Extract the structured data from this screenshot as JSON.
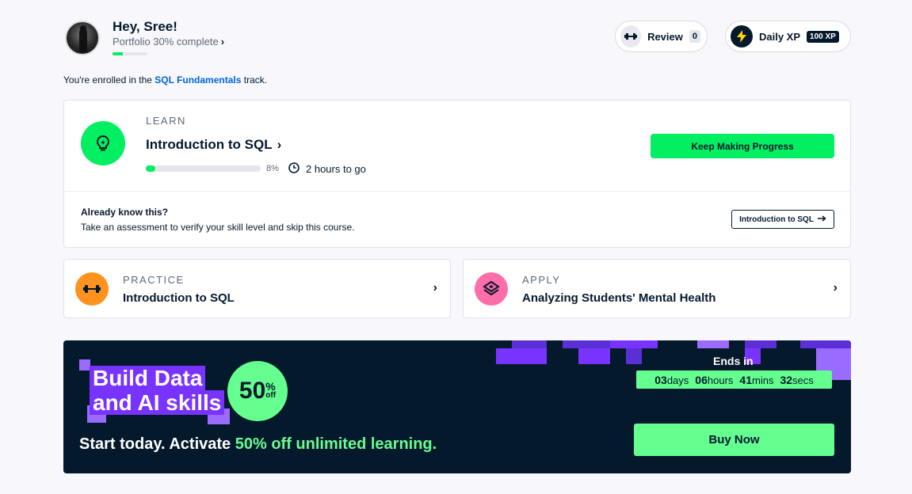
{
  "header": {
    "greeting": "Hey, Sree!",
    "portfolio_text": "Portfolio 30% complete",
    "portfolio_progress": 0.3,
    "review_label": "Review",
    "review_count": "0",
    "xp_label": "Daily XP",
    "xp_value": "100 XP"
  },
  "track": {
    "prefix": "You're enrolled in the",
    "name": "SQL Fundamentals",
    "suffix": "track."
  },
  "learn": {
    "tag": "LEARN",
    "title": "Introduction to SQL",
    "progress_percent": 8,
    "progress_label": "8%",
    "time_left": "2 hours to go",
    "cta": "Keep Making Progress",
    "already_title": "Already know this?",
    "already_desc": "Take an assessment to verify your skill level and skip this course.",
    "assessment_button": "Introduction to SQL"
  },
  "practice": {
    "tag": "PRACTICE",
    "title": "Introduction to SQL"
  },
  "apply": {
    "tag": "APPLY",
    "title": "Analyzing Students' Mental Health"
  },
  "promo": {
    "headline_line1": "Build Data",
    "headline_line2": "and AI skills",
    "discount_number": "50",
    "discount_percent": "%",
    "discount_off": "off",
    "sub_prefix": "Start today. Activate",
    "sub_highlight": "50% off unlimited learning.",
    "ends_label": "Ends in",
    "days": "03",
    "days_unit": "days",
    "hours": "06",
    "hours_unit": "hours",
    "mins": "41",
    "mins_unit": "mins",
    "secs": "32",
    "secs_unit": "secs",
    "buy_label": "Buy Now"
  },
  "colors": {
    "brand_green": "#03ef62",
    "promo_green": "#65ff8f",
    "navy": "#05192d",
    "purple": "#7933ff",
    "link_blue": "#0065d1",
    "practice_orange": "#ff931e",
    "apply_pink": "#ff6ea9"
  },
  "icons": {
    "review": "dumbbell-icon",
    "xp": "lightning-icon",
    "learn": "lightbulb-icon",
    "practice": "dumbbell-icon",
    "apply": "layers-icon",
    "time": "clock-icon"
  }
}
